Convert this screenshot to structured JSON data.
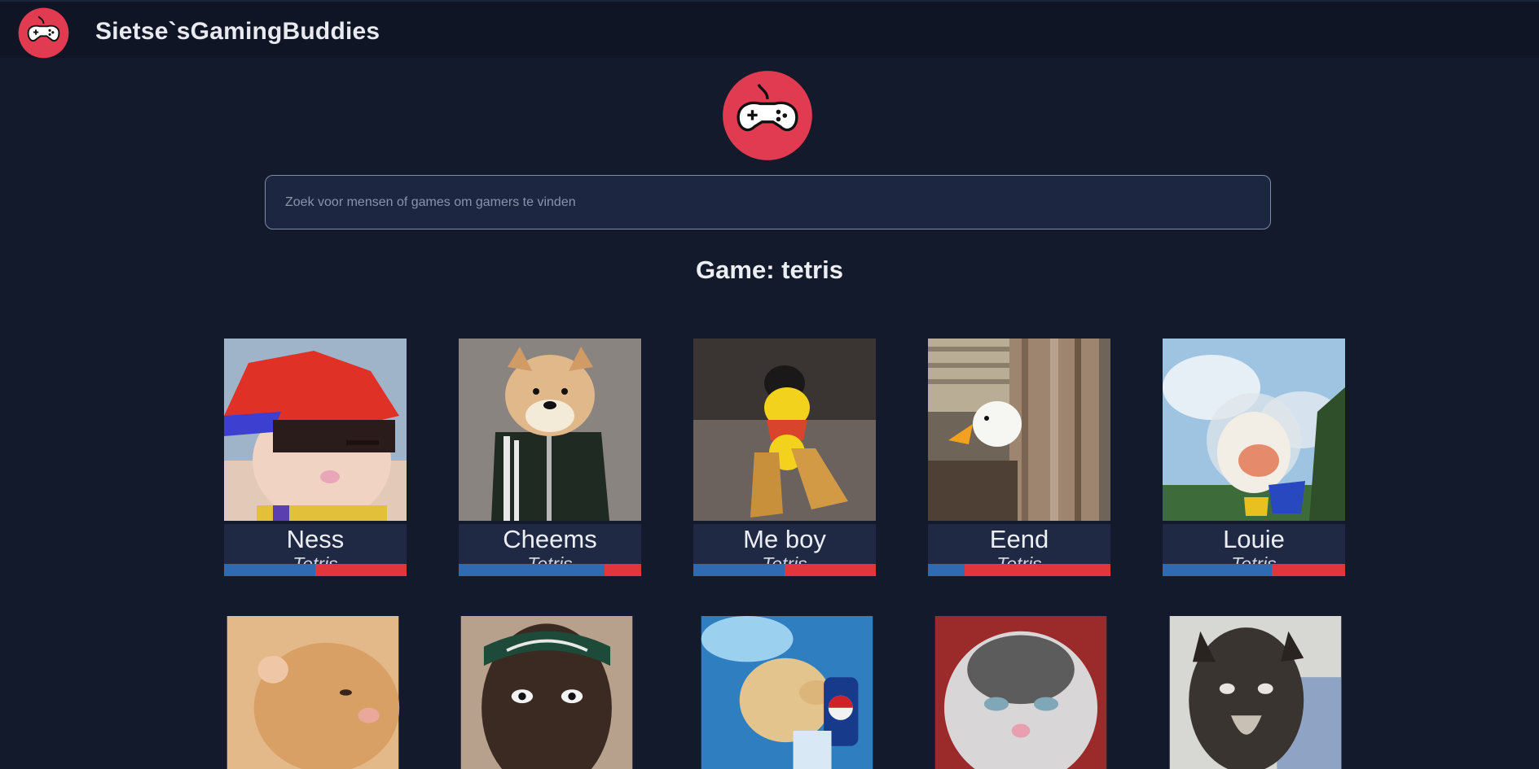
{
  "nav": {
    "title": "Sietse`sGamingBuddies",
    "logo_icon": "gamepad-icon"
  },
  "hero": {
    "logo_icon": "gamepad-icon"
  },
  "search": {
    "placeholder": "Zoek voor mensen of games om gamers te vinden",
    "value": ""
  },
  "heading": "Game: tetris",
  "colors": {
    "background": "#131a2c",
    "navbar": "#0f1524",
    "card_info": "#1f2944",
    "logo_red": "#e13b52",
    "bar_blue": "#2f6bb3",
    "bar_red": "#e0363c"
  },
  "players": [
    {
      "name": "Ness",
      "game": "Tetris",
      "ratio": 0.5
    },
    {
      "name": "Cheems",
      "game": "Tetris",
      "ratio": 0.8
    },
    {
      "name": "Me boy",
      "game": "Tetris",
      "ratio": 0.5
    },
    {
      "name": "Eend",
      "game": "Tetris",
      "ratio": 0.2
    },
    {
      "name": "Louie",
      "game": "Tetris",
      "ratio": 0.6
    }
  ],
  "second_row": [
    {
      "image": "hamster-photo"
    },
    {
      "image": "man-headband-photo"
    },
    {
      "image": "puppy-pepsi-photo"
    },
    {
      "image": "kitten-photo"
    },
    {
      "image": "wet-cat-photo"
    }
  ]
}
